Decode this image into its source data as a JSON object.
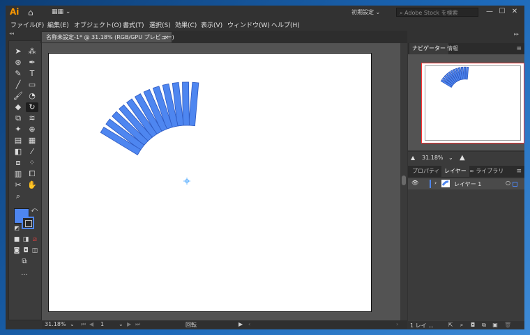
{
  "app": {
    "logo": "Ai",
    "workspace": "初期設定",
    "search_placeholder": "Adobe Stock を検索",
    "window_controls": {
      "minimize": "—",
      "maximize": "☐",
      "close": "✕"
    }
  },
  "menu": [
    "ファイル(F)",
    "編集(E)",
    "オブジェクト(O)",
    "書式(T)",
    "選択(S)",
    "効果(C)",
    "表示(V)",
    "ウィンドウ(W)",
    "ヘルプ(H)"
  ],
  "document": {
    "tab_title": "名称未設定-1* @ 31.18% (RGB/GPU プレビュー)",
    "close_label": "×"
  },
  "status": {
    "zoom": "31.18%",
    "artboard": "1",
    "tool_name": "回転"
  },
  "navigator": {
    "tabs": [
      "ナビゲーター",
      "情報"
    ],
    "zoom": "31.18%"
  },
  "layers_panel": {
    "tabs": [
      "プロパティ",
      "レイヤー",
      "ライブラリ"
    ],
    "layers": [
      {
        "name": "レイヤー 1"
      }
    ],
    "footer_count": "1 レイ ..."
  },
  "icons": {
    "home": "home-icon",
    "search": "search-icon",
    "eye": "eye-icon"
  },
  "colors": {
    "fill": "#4e86f0",
    "stroke": "#2e59c0",
    "accent": "#ff9a00"
  }
}
